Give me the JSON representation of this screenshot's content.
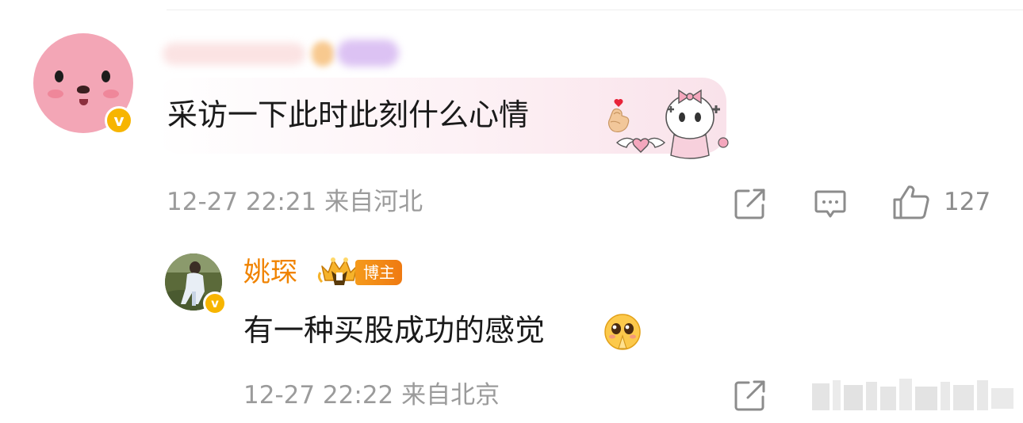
{
  "main_comment": {
    "text": "采访一下此时此刻什么心情",
    "timestamp": "12-27 22:21",
    "location": "来自河北",
    "like_count": "127",
    "emoji": "finger-heart-emoji",
    "verified": "v"
  },
  "reply": {
    "username": "姚琛",
    "badge_label": "博主",
    "text": "有一种买股成功的感觉",
    "timestamp": "12-27 22:22",
    "location": "来自北京",
    "emoji": "pleading-pray-emoji",
    "verified": "v"
  },
  "colors": {
    "username_orange": "#f08300",
    "meta_gray": "#9b9b9b",
    "verified_gold": "#f7b500",
    "avatar_pink": "#f3a6b6"
  },
  "icons": [
    "share-icon",
    "comment-icon",
    "like-icon"
  ]
}
